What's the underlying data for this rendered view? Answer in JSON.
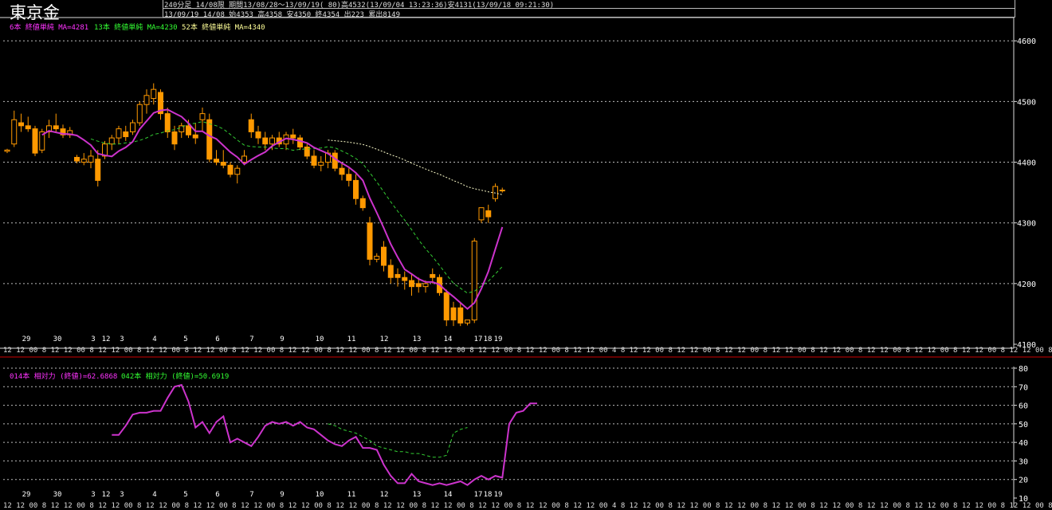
{
  "header": {
    "title": "東京金",
    "line1": "240分足 14/08限 期間13/08/28～13/09/19( 80)高4532(13/09/04 13:23:36)安4131(13/09/18 09:21:30)",
    "line2": "13/09/19 14/08 始4353 高4358 安4350 終4354 出223 累出8149"
  },
  "legends": {
    "price": [
      {
        "text": "6本 終値単純 MA=4281",
        "color": "#ff33ff"
      },
      {
        "text": "13本 終値単純 MA=4230",
        "color": "#33ff33"
      },
      {
        "text": "52本 終値単純 MA=4340",
        "color": "#ffff99"
      }
    ],
    "osc": [
      {
        "text": "014本 相対力 (終値)=62.6868",
        "color": "#ff33ff"
      },
      {
        "text": "042本 相対力 (終値)=50.6919",
        "color": "#33ff33"
      }
    ]
  },
  "colors": {
    "background": "#000000",
    "candle_up": "#ff9900",
    "candle_down": "#ff9900",
    "ma6": "#cc33cc",
    "ma13": "#33cc33",
    "ma52": "#ffffcc",
    "rsi14": "#cc33cc",
    "rsi42": "#33cc33",
    "separator": "#cc0000"
  },
  "chart_data": [
    {
      "type": "candlestick",
      "ylim": [
        4100,
        4620
      ],
      "yticks": [
        4100,
        4200,
        4300,
        4400,
        4500,
        4600
      ],
      "date_labels": [
        "29",
        "30",
        "3",
        "12",
        "3",
        "4",
        "5",
        "6",
        "7",
        "9",
        "10",
        "11",
        "12",
        "13",
        "14",
        "17",
        "18",
        "19"
      ],
      "bar_time_label_row": "12 12 00 8 12 12 00 8 12 12 00 8 12 12 00 8 12 12 00 8 12 12 00 8 12 12 00 8 12 12 00 8 12 12 00 8 12 12 00 8 12 12 00 8 12 12 00 8 12 12 00 4 8 12 12 00 8 12 12 00 8 12 12 00 8 12 12 00 8 12 12 00 8 12 12 00 8 12 12 00 8 12 12 00 8 12 12 00 8 12 20",
      "candles": [
        [
          4418,
          4422,
          4415,
          4420
        ],
        [
          4430,
          4485,
          4425,
          4470
        ],
        [
          4465,
          4480,
          4450,
          4460
        ],
        [
          4460,
          4475,
          4450,
          4455
        ],
        [
          4455,
          4460,
          4410,
          4415
        ],
        [
          4420,
          4455,
          4415,
          4450
        ],
        [
          4450,
          4470,
          4440,
          4460
        ],
        [
          4460,
          4480,
          4450,
          4455
        ],
        [
          4455,
          4462,
          4440,
          4445
        ],
        [
          4445,
          4458,
          4440,
          4452
        ],
        [
          4408,
          4412,
          4398,
          4402
        ],
        [
          4400,
          4415,
          4395,
          4405
        ],
        [
          4400,
          4420,
          4390,
          4410
        ],
        [
          4405,
          4420,
          4360,
          4370
        ],
        [
          4410,
          4435,
          4405,
          4430
        ],
        [
          4430,
          4445,
          4420,
          4440
        ],
        [
          4440,
          4460,
          4430,
          4455
        ],
        [
          4450,
          4460,
          4435,
          4442
        ],
        [
          4450,
          4470,
          4445,
          4465
        ],
        [
          4465,
          4500,
          4460,
          4495
        ],
        [
          4495,
          4520,
          4480,
          4510
        ],
        [
          4505,
          4530,
          4495,
          4520
        ],
        [
          4515,
          4520,
          4470,
          4480
        ],
        [
          4480,
          4490,
          4440,
          4450
        ],
        [
          4450,
          4460,
          4420,
          4430
        ],
        [
          4450,
          4465,
          4440,
          4460
        ],
        [
          4460,
          4470,
          4440,
          4445
        ],
        [
          4445,
          4465,
          4430,
          4440
        ],
        [
          4470,
          4490,
          4450,
          4480
        ],
        [
          4470,
          4480,
          4400,
          4405
        ],
        [
          4405,
          4420,
          4395,
          4400
        ],
        [
          4400,
          4420,
          4390,
          4395
        ],
        [
          4395,
          4400,
          4375,
          4380
        ],
        [
          4380,
          4395,
          4365,
          4390
        ],
        [
          4400,
          4420,
          4395,
          4410
        ],
        [
          4470,
          4480,
          4440,
          4450
        ],
        [
          4450,
          4460,
          4430,
          4440
        ],
        [
          4440,
          4450,
          4420,
          4430
        ],
        [
          4430,
          4445,
          4420,
          4440
        ],
        [
          4440,
          4450,
          4425,
          4430
        ],
        [
          4430,
          4450,
          4420,
          4445
        ],
        [
          4445,
          4455,
          4430,
          4440
        ],
        [
          4440,
          4445,
          4420,
          4425
        ],
        [
          4425,
          4430,
          4405,
          4410
        ],
        [
          4410,
          4420,
          4390,
          4395
        ],
        [
          4395,
          4410,
          4385,
          4400
        ],
        [
          4400,
          4420,
          4390,
          4415
        ],
        [
          4415,
          4420,
          4385,
          4390
        ],
        [
          4390,
          4400,
          4370,
          4380
        ],
        [
          4380,
          4390,
          4360,
          4370
        ],
        [
          4370,
          4380,
          4330,
          4340
        ],
        [
          4340,
          4345,
          4320,
          4325
        ],
        [
          4300,
          4310,
          4230,
          4240
        ],
        [
          4240,
          4250,
          4235,
          4245
        ],
        [
          4260,
          4270,
          4220,
          4230
        ],
        [
          4230,
          4240,
          4200,
          4210
        ],
        [
          4215,
          4225,
          4195,
          4210
        ],
        [
          4210,
          4220,
          4190,
          4205
        ],
        [
          4205,
          4215,
          4180,
          4195
        ],
        [
          4200,
          4210,
          4185,
          4195
        ],
        [
          4195,
          4205,
          4185,
          4200
        ],
        [
          4215,
          4225,
          4200,
          4210
        ],
        [
          4210,
          4215,
          4180,
          4185
        ],
        [
          4185,
          4190,
          4130,
          4140
        ],
        [
          4160,
          4170,
          4130,
          4140
        ],
        [
          4160,
          4170,
          4130,
          4135
        ],
        [
          4135,
          4140,
          4131,
          4140
        ],
        [
          4140,
          4275,
          4135,
          4270
        ],
        [
          4305,
          4320,
          4300,
          4325
        ],
        [
          4320,
          4330,
          4300,
          4310
        ],
        [
          4340,
          4365,
          4335,
          4360
        ],
        [
          4354,
          4358,
          4350,
          4354
        ]
      ]
    },
    {
      "type": "line",
      "name": "014本 相対力 (終値)",
      "ylim": [
        10,
        80
      ],
      "yticks": [
        10,
        20,
        30,
        40,
        50,
        60,
        70,
        80
      ],
      "values": [
        44,
        44,
        49,
        55,
        56,
        56,
        57,
        57,
        64,
        70,
        71,
        62,
        48,
        51,
        45,
        51,
        54,
        40,
        42,
        40,
        38,
        43,
        49,
        51,
        50,
        51,
        49,
        51,
        48,
        47,
        44,
        41,
        39,
        38,
        41,
        43,
        37,
        37,
        36,
        28,
        22,
        18,
        18,
        23,
        19,
        18,
        17,
        18,
        17,
        18,
        19,
        17,
        20,
        22,
        20,
        22,
        21,
        50,
        56,
        57,
        61,
        61
      ],
      "x_start_index": 15
    },
    {
      "type": "line",
      "name": "042本 相対力 (終値)",
      "values": [
        50,
        49,
        47,
        46,
        45,
        43,
        41,
        38,
        37,
        36,
        35,
        35,
        34,
        34,
        33,
        32,
        32,
        33,
        45,
        47,
        48
      ],
      "x_start_index": 46
    }
  ]
}
